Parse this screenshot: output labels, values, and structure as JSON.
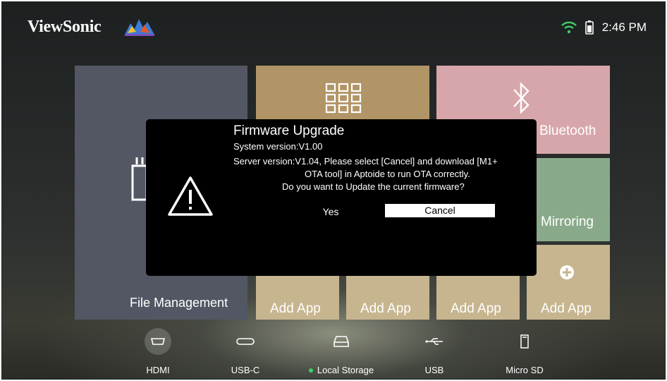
{
  "brand": "ViewSonic",
  "status": {
    "time": "2:46 PM",
    "wifi_icon": "wifi-icon",
    "battery_icon": "battery-icon"
  },
  "tiles": {
    "file_management": "File Management",
    "apps_icon": "grid-icon",
    "bluetooth": "Bluetooth",
    "mirroring": "Mirroring",
    "add_app": [
      "Add App",
      "Add App",
      "Add App",
      "Add App"
    ]
  },
  "dialog": {
    "title": "Firmware Upgrade",
    "system_version": "System version:V1.00",
    "server_line1": "Server version:V1.04, Please select [Cancel] and download [M1+",
    "server_line2": "OTA tool] in Aptoide to run OTA correctly.",
    "question": "Do you want to Update the current firmware?",
    "yes_label": "Yes",
    "cancel_label": "Cancel",
    "warning_icon": "warning-icon"
  },
  "sources": [
    {
      "label": "HDMI",
      "icon": "hdmi-icon"
    },
    {
      "label": "USB-C",
      "icon": "usb-c-icon"
    },
    {
      "label": "Local Storage",
      "icon": "local-storage-icon",
      "active": true
    },
    {
      "label": "USB",
      "icon": "usb-icon"
    },
    {
      "label": "Micro SD",
      "icon": "micro-sd-icon"
    }
  ],
  "colors": {
    "file_tile": "#525763",
    "apps_tile": "#b29566",
    "bluetooth_tile": "#d7a6ab",
    "mirroring_tile": "#89aa8a",
    "add_app_tile": "#c7b58f",
    "active_dot": "#3fcf6a"
  }
}
